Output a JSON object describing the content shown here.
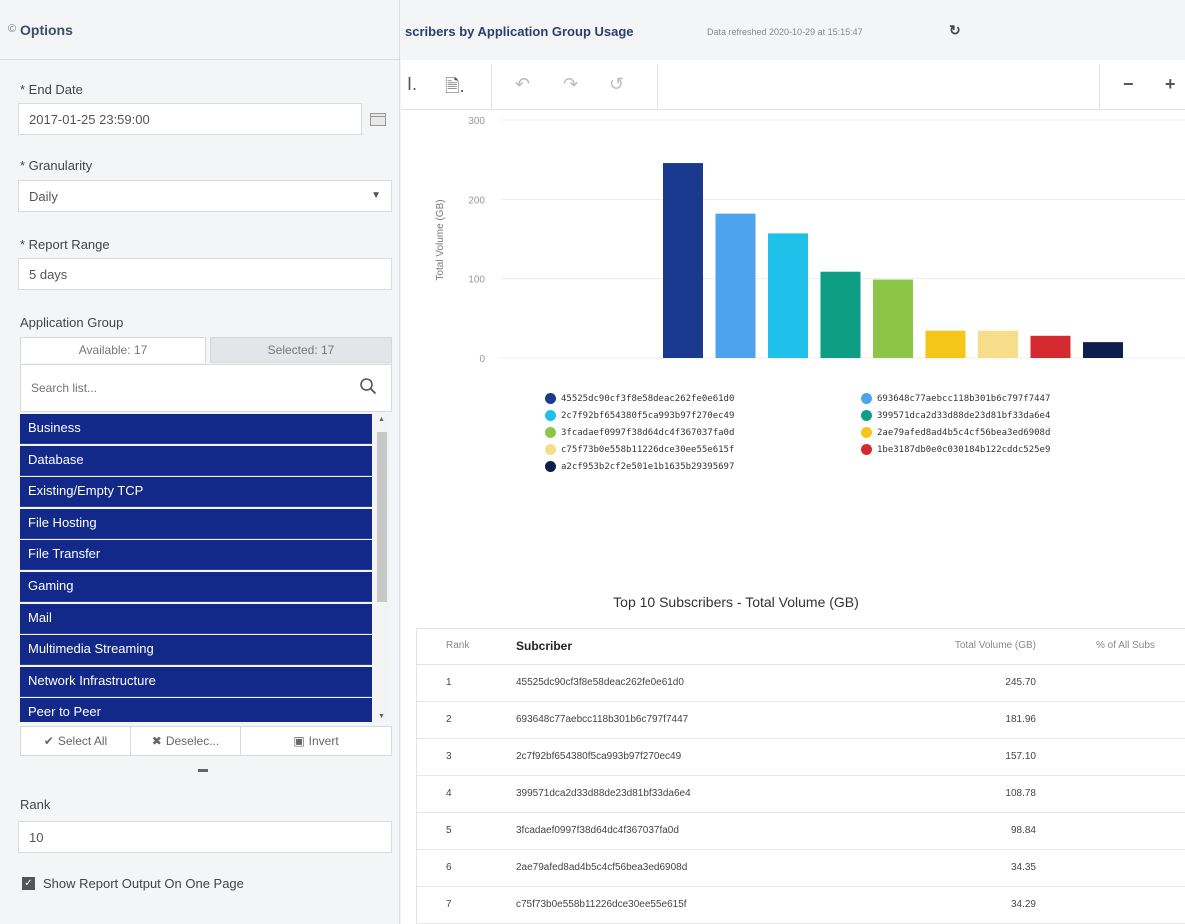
{
  "options": {
    "title": "Options",
    "end_date": {
      "label": "* End Date",
      "value": "2017-01-25 23:59:00"
    },
    "granularity": {
      "label": "* Granularity",
      "value": "Daily"
    },
    "report_range": {
      "label": "* Report Range",
      "value": "5 days"
    },
    "application_group": {
      "label": "Application Group",
      "tab_available": "Available: 17",
      "tab_selected": "Selected: 17",
      "search_placeholder": "Search list...",
      "items": [
        "Business",
        "Database",
        "Existing/Empty TCP",
        "File Hosting",
        "File Transfer",
        "Gaming",
        "Mail",
        "Multimedia Streaming",
        "Network Infrastructure",
        "Peer to Peer"
      ],
      "select_all": "Select All",
      "deselect": "Deselec...",
      "invert": "Invert"
    },
    "rank": {
      "label": "Rank",
      "value": "10"
    },
    "show_one_page": "Show Report Output On One Page"
  },
  "report": {
    "title": "scribers by Application Group Usage",
    "refreshed": "Data refreshed 2020-10-29 at 15:15:47"
  },
  "chart_data": {
    "type": "bar",
    "ylabel": "Total Volume (GB)",
    "ylim": [
      0,
      300
    ],
    "yticks": [
      "0",
      "100",
      "200",
      "300"
    ],
    "series": [
      {
        "name": "45525dc90cf3f8e58deac262fe0e61d0",
        "value": 245.7,
        "color": "#1a3a8f"
      },
      {
        "name": "693648c77aebcc118b301b6c797f7447",
        "value": 181.96,
        "color": "#4da3ee"
      },
      {
        "name": "2c7f92bf654380f5ca993b97f270ec49",
        "value": 157.1,
        "color": "#1fc0ea"
      },
      {
        "name": "399571dca2d33d88de23d81bf33da6e4",
        "value": 108.78,
        "color": "#0e9e86"
      },
      {
        "name": "3fcadaef0997f38d64dc4f367037fa0d",
        "value": 98.84,
        "color": "#8dc549"
      },
      {
        "name": "2ae79afed8ad4b5c4cf56bea3ed6908d",
        "value": 34.35,
        "color": "#f5c518"
      },
      {
        "name": "c75f73b0e558b11226dce30ee55e615f",
        "value": 34.29,
        "color": "#f5dd8a"
      },
      {
        "name": "1be3187db0e0c030184b122cddc525e9",
        "value": 28.0,
        "color": "#d42a2f"
      },
      {
        "name": "a2cf953b2cf2e501e1b1635b29395697",
        "value": 20.0,
        "color": "#0f1f4d"
      }
    ]
  },
  "table": {
    "title": "Top 10 Subscribers - Total Volume (GB)",
    "headers": {
      "rank": "Rank",
      "subscriber": "Subcriber",
      "volume": "Total Volume (GB)",
      "pct": "% of All Subs"
    },
    "rows": [
      {
        "rank": "1",
        "subscriber": "45525dc90cf3f8e58deac262fe0e61d0",
        "volume": "245.70"
      },
      {
        "rank": "2",
        "subscriber": "693648c77aebcc118b301b6c797f7447",
        "volume": "181.96"
      },
      {
        "rank": "3",
        "subscriber": "2c7f92bf654380f5ca993b97f270ec49",
        "volume": "157.10"
      },
      {
        "rank": "4",
        "subscriber": "399571dca2d33d88de23d81bf33da6e4",
        "volume": "108.78"
      },
      {
        "rank": "5",
        "subscriber": "3fcadaef0997f38d64dc4f367037fa0d",
        "volume": "98.84"
      },
      {
        "rank": "6",
        "subscriber": "2ae79afed8ad4b5c4cf56bea3ed6908d",
        "volume": "34.35"
      },
      {
        "rank": "7",
        "subscriber": "c75f73b0e558b11226dce30ee55e615f",
        "volume": "34.29"
      }
    ]
  }
}
